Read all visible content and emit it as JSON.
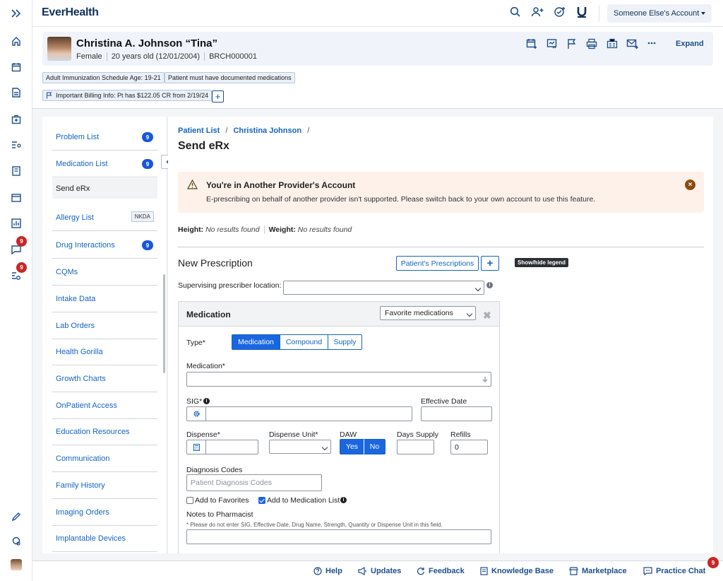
{
  "app": {
    "logo": "EverHealth"
  },
  "topbar": {
    "account_label": "Someone Else's Account"
  },
  "rail": {
    "badges": [
      "9",
      "9"
    ]
  },
  "patient": {
    "name": "Christina A. Johnson “Tina”",
    "sex": "Female",
    "age": "20 years old (12/01/2004)",
    "mrn": "BRCH000001",
    "expand_label": "Expand",
    "chips": [
      "Adult Immunization Schedule Age: 19-21",
      "Patient must have documented medications",
      "Important Billing Info: Pt has $122.05 CR from 2/19/24"
    ]
  },
  "sidenav": {
    "items": [
      {
        "label": "Problem List",
        "count": "9"
      },
      {
        "label": "Medication List",
        "count": "9"
      },
      {
        "label": "Send eRx"
      },
      {
        "label": "Allergy List",
        "tag": "NKDA"
      },
      {
        "label": "Drug Interactions",
        "count": "9"
      },
      {
        "label": "CQMs"
      },
      {
        "label": "Intake Data"
      },
      {
        "label": "Lab Orders"
      },
      {
        "label": "Health Gorilla"
      },
      {
        "label": "Growth Charts"
      },
      {
        "label": "OnPatient Access"
      },
      {
        "label": "Education Resources"
      },
      {
        "label": "Communication"
      },
      {
        "label": "Family History"
      },
      {
        "label": "Imaging Orders"
      },
      {
        "label": "Implantable Devices"
      }
    ]
  },
  "main": {
    "breadcrumb": {
      "first": "Patient List",
      "second": "Christina Johnson",
      "sep": "/"
    },
    "title": "Send eRx",
    "alert": {
      "title": "You're in Another Provider's Account",
      "text": "E-prescribing on behalf of another provider isn't supported. Please switch back to your own account to use this feature."
    },
    "vitals": {
      "height_label": "Height:",
      "height_value": "No results found",
      "weight_label": "Weight:",
      "weight_value": "No results found"
    },
    "new_rx": {
      "title": "New Prescription",
      "patients_rx_button": "Patient's Prescriptions",
      "legend_label": "Show/hide legend",
      "supervising_label": "Supervising prescriber location:",
      "supervising_value": ""
    },
    "medication": {
      "title": "Medication",
      "favorites_value": "Favorite medications",
      "type_label": "Type*",
      "type_options": [
        "Medication",
        "Compound",
        "Supply"
      ],
      "medication_label": "Medication*",
      "sig_label": "SIG*",
      "effective_date_label": "Effective Date",
      "dispense_label": "Dispense*",
      "dispense_unit_label": "Dispense Unit*",
      "daw_label": "DAW",
      "daw_yes": "Yes",
      "daw_no": "No",
      "days_supply_label": "Days Supply",
      "refills_label": "Refills",
      "refills_value": "0",
      "diagnosis_label": "Diagnosis Codes",
      "diagnosis_placeholder": "Patient Diagnosis Codes",
      "add_favorites_label": "Add to Favorites",
      "add_medlist_label": "Add to Medication List",
      "notes_label": "Notes to Pharmacist",
      "notes_hint": "* Please do not enter SIG, Effective Date, Drug Name, Strength, Quantity or Dispense Unit in this field."
    }
  },
  "footer": {
    "help": "Help",
    "updates": "Updates",
    "feedback": "Feedback",
    "knowledge_base": "Knowledge Base",
    "marketplace": "Marketplace",
    "practice_chat": "Practice Chat",
    "chat_badge": "9"
  },
  "colors": {
    "accent": "#1565c0",
    "brand": "#12305c",
    "badge": "#c62828",
    "alert_bg": "#fdf1ea"
  }
}
